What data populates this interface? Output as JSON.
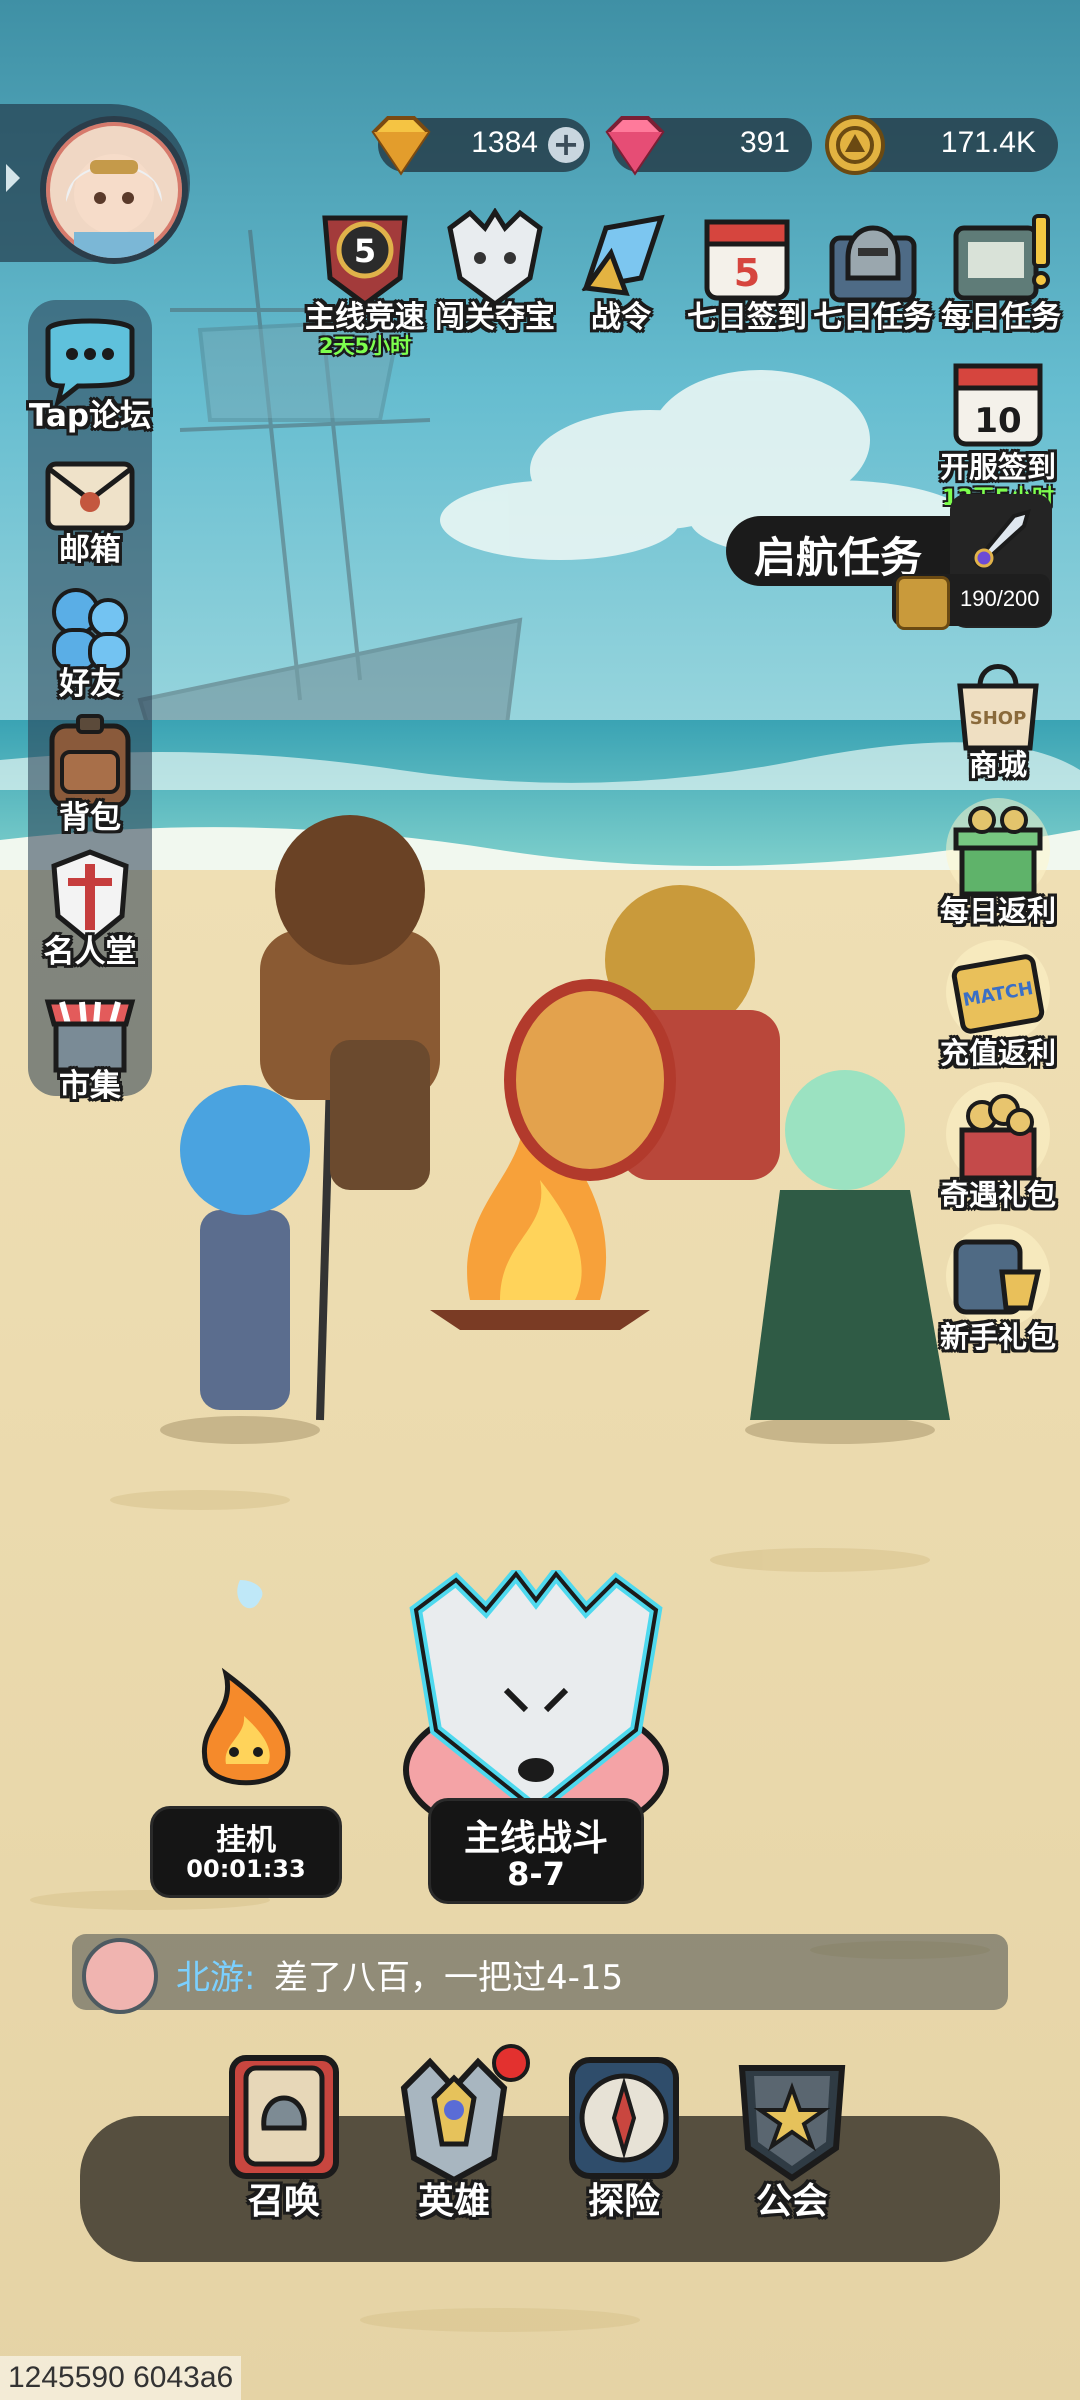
{
  "currencies": [
    {
      "icon": "gold-diamond-icon",
      "value": "1384",
      "has_add": true
    },
    {
      "icon": "pink-gem-icon",
      "value": "391"
    },
    {
      "icon": "gold-coin-icon",
      "value": "171.4K"
    }
  ],
  "top_icons": [
    {
      "label": "主线竞速",
      "sub": "2天5小时",
      "badge": "5",
      "icon": "race-shield-icon"
    },
    {
      "label": "闯关夺宝",
      "icon": "wolf-mask-icon"
    },
    {
      "label": "战令",
      "icon": "battle-pass-icon"
    },
    {
      "label": "七日签到",
      "icon": "calendar-icon",
      "badge": "5"
    },
    {
      "label": "七日任务",
      "icon": "helmet-book-icon"
    },
    {
      "label": "每日任务",
      "icon": "daily-task-book-icon"
    }
  ],
  "left_sidebar": [
    {
      "label": "Tap论坛",
      "icon": "chat-bubble-icon"
    },
    {
      "label": "邮箱",
      "icon": "mail-envelope-icon"
    },
    {
      "label": "好友",
      "icon": "friends-icon"
    },
    {
      "label": "背包",
      "icon": "backpack-icon"
    },
    {
      "label": "名人堂",
      "icon": "hall-of-fame-icon"
    },
    {
      "label": "市集",
      "icon": "market-stall-icon"
    }
  ],
  "voyage_task": {
    "title": "启航任务",
    "progress_text": "190/200",
    "progress": 0.95
  },
  "right_icons": [
    {
      "label": "开服签到",
      "sub": "13天5小时",
      "icon": "server-calendar-icon",
      "badge": "10"
    },
    {
      "label": "商城",
      "icon": "shop-bag-icon",
      "badge": "SHOP"
    },
    {
      "label": "每日返利",
      "icon": "gift-box-icon"
    },
    {
      "label": "充值返利",
      "icon": "match-ticket-icon",
      "badge": "MATCH"
    },
    {
      "label": "奇遇礼包",
      "icon": "treasure-gift-icon"
    },
    {
      "label": "新手礼包",
      "icon": "novice-gift-icon"
    }
  ],
  "idle": {
    "label": "挂机",
    "time": "00:01:33"
  },
  "main_battle": {
    "label": "主线战斗",
    "stage": "8-7"
  },
  "chat": {
    "name": "北游:",
    "message": "差了八百，一把过4-15"
  },
  "bottom_nav": [
    {
      "label": "召唤",
      "icon": "summon-icon"
    },
    {
      "label": "英雄",
      "icon": "hero-icon",
      "notification": true
    },
    {
      "label": "探险",
      "icon": "explore-compass-icon"
    },
    {
      "label": "公会",
      "icon": "guild-star-icon"
    }
  ],
  "debug_text": "1245590 6043a6",
  "colors": {
    "sky": "#5fb6c9",
    "sand": "#e9d9ae",
    "label_outline": "#1b1b1b",
    "timer_green": "#7dff4e",
    "chat_name": "#7bd0ff"
  }
}
